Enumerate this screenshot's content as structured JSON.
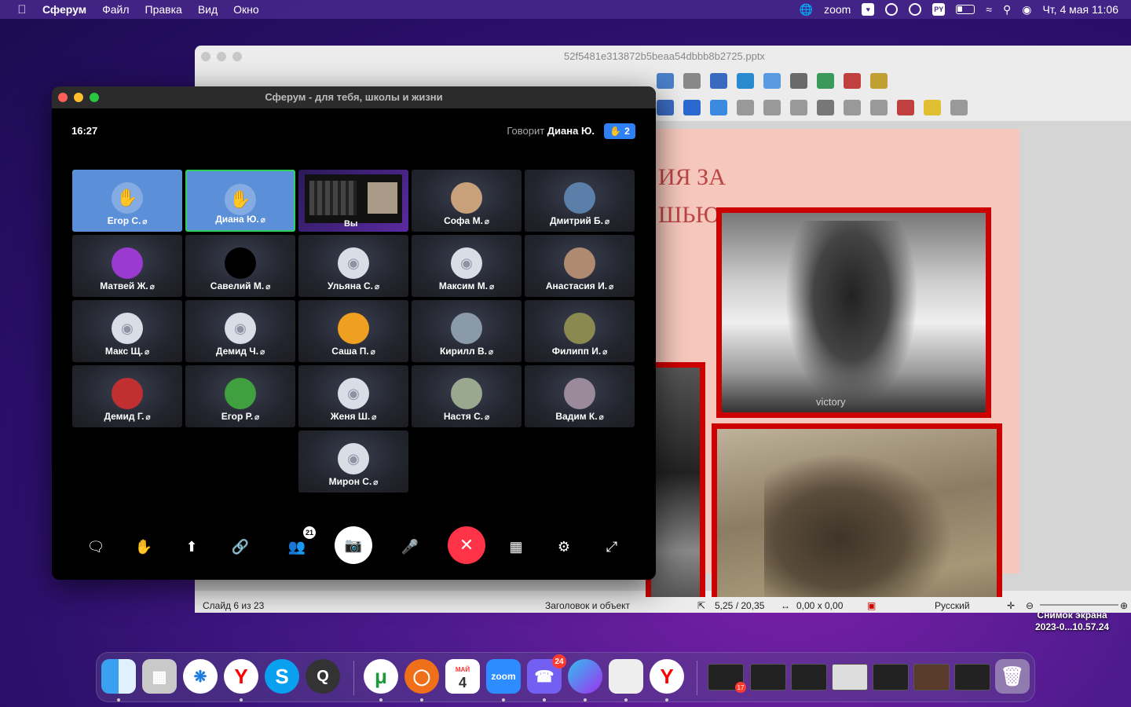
{
  "menubar": {
    "app_name": "Сферум",
    "items": [
      "Файл",
      "Правка",
      "Вид",
      "Окно"
    ],
    "zoom_label": "zoom",
    "keyboard_layout": "PY",
    "date_time": "Чт, 4 мая  11:06"
  },
  "impress": {
    "doc_title": "52f5481e313872b5beaa54dbbb8b2725.pptx",
    "slide_title_line1": "ИЯ ЗА",
    "slide_title_line2": "ШЬЮ",
    "watermark": "victory",
    "status": {
      "slide": "Слайд 6 из 23",
      "layout": "Заголовок и объект",
      "position": "5,25 / 20,35",
      "size": "0,00 x 0,00",
      "language": "Русский"
    }
  },
  "sferum": {
    "window_title": "Сферум - для тебя, школы и жизни",
    "call_time": "16:27",
    "speaking_prefix": "Говорит",
    "speaking_name": "Диана Ю.",
    "raised_hands": "2",
    "share_label": "Вы",
    "participants_count": "21",
    "participants": [
      {
        "name": "Егор С.",
        "state": "hand"
      },
      {
        "name": "Диана Ю.",
        "state": "hand-active"
      },
      {
        "name": "",
        "state": "share"
      },
      {
        "name": "Софа М.",
        "state": "photo",
        "color": "#c8a07a"
      },
      {
        "name": "Дмитрий Б.",
        "state": "photo",
        "color": "#5b7fa8"
      },
      {
        "name": "Матвей Ж.",
        "state": "photo",
        "color": "#9a3ad0"
      },
      {
        "name": "Савелий М.",
        "state": "photo",
        "color": "#000000"
      },
      {
        "name": "Ульяна С.",
        "state": "camera"
      },
      {
        "name": "Максим М.",
        "state": "camera"
      },
      {
        "name": "Анастасия И.",
        "state": "photo",
        "color": "#b08a70"
      },
      {
        "name": "Макс Щ.",
        "state": "camera"
      },
      {
        "name": "Демид Ч.",
        "state": "camera"
      },
      {
        "name": "Саша П.",
        "state": "photo",
        "color": "#f0a020"
      },
      {
        "name": "Кирилл В.",
        "state": "photo",
        "color": "#8a9aa8"
      },
      {
        "name": "Филипп И.",
        "state": "photo",
        "color": "#8a8a50"
      },
      {
        "name": "Демид Г.",
        "state": "photo",
        "color": "#c03030"
      },
      {
        "name": "Егор Р.",
        "state": "photo",
        "color": "#40a040"
      },
      {
        "name": "Женя Ш.",
        "state": "camera"
      },
      {
        "name": "Настя С.",
        "state": "photo",
        "color": "#9aa890"
      },
      {
        "name": "Вадим К.",
        "state": "photo",
        "color": "#9a8a9a"
      },
      {
        "name": "Мирон С.",
        "state": "camera"
      }
    ]
  },
  "screenshot_label": {
    "line1": "Снимок экрана",
    "line2": "2023-0...10.57.24"
  },
  "dock": {
    "calendar_month": "МАЙ",
    "calendar_day": "4",
    "zoom": "zoom",
    "viber_badge": "24",
    "thumb_badge": "17"
  }
}
